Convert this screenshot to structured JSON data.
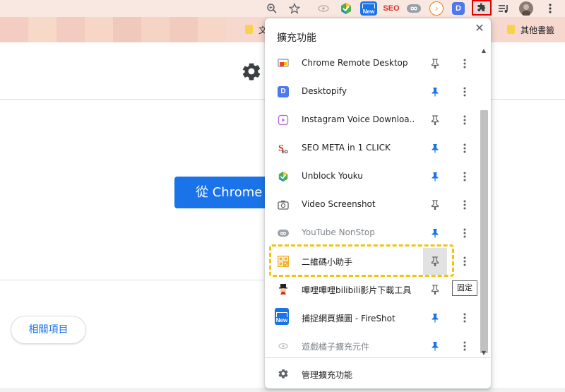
{
  "toolbar": {
    "new_badge": "New",
    "seo_badge": "SEO",
    "d_badge": "D"
  },
  "bookmarks": {
    "truncated_folder": "文",
    "other_bookmarks": "其他書籤"
  },
  "page": {
    "cta_label": "從 Chrome 線",
    "related_button": "相關項目"
  },
  "popup": {
    "title": "擴充功能",
    "close_glyph": "✕",
    "manage_label": "管理擴充功能",
    "tooltip": "固定",
    "extensions": [
      {
        "name": "Chrome Remote Desktop",
        "pinned": false,
        "icon": "remote-desktop-icon"
      },
      {
        "name": "Desktopify",
        "pinned": true,
        "icon": "desktopify-icon",
        "badge": "D"
      },
      {
        "name": "Instagram Voice Downloa...",
        "pinned": false,
        "icon": "instagram-voice-icon"
      },
      {
        "name": "SEO META in 1 CLICK",
        "pinned": true,
        "icon": "seo-meta-icon",
        "badge": "S"
      },
      {
        "name": "Unblock Youku",
        "pinned": true,
        "icon": "unblock-youku-icon"
      },
      {
        "name": "Video Screenshot",
        "pinned": false,
        "icon": "camera-icon"
      },
      {
        "name": "YouTube NonStop",
        "pinned": true,
        "icon": "youtube-nonstop-icon",
        "faded": true
      },
      {
        "name": "二維碼小助手",
        "pinned": false,
        "icon": "qr-code-icon",
        "hovered": true
      },
      {
        "name": "嗶哩嗶哩bilibili影片下載工具",
        "pinned": false,
        "icon": "bilibili-icon"
      },
      {
        "name": "捕捉網頁擷圖 - FireShot",
        "pinned": true,
        "icon": "fireshot-icon",
        "badge": "New"
      },
      {
        "name": "遊戲橘子擴充元件",
        "pinned": true,
        "icon": "gamania-icon",
        "faded": true
      }
    ]
  },
  "colors": {
    "accent": "#1a73e8",
    "pin_active": "#1a73e8",
    "pin_inactive": "#5f6368",
    "highlight": "#f2c40f",
    "annotation": "#e00000"
  }
}
